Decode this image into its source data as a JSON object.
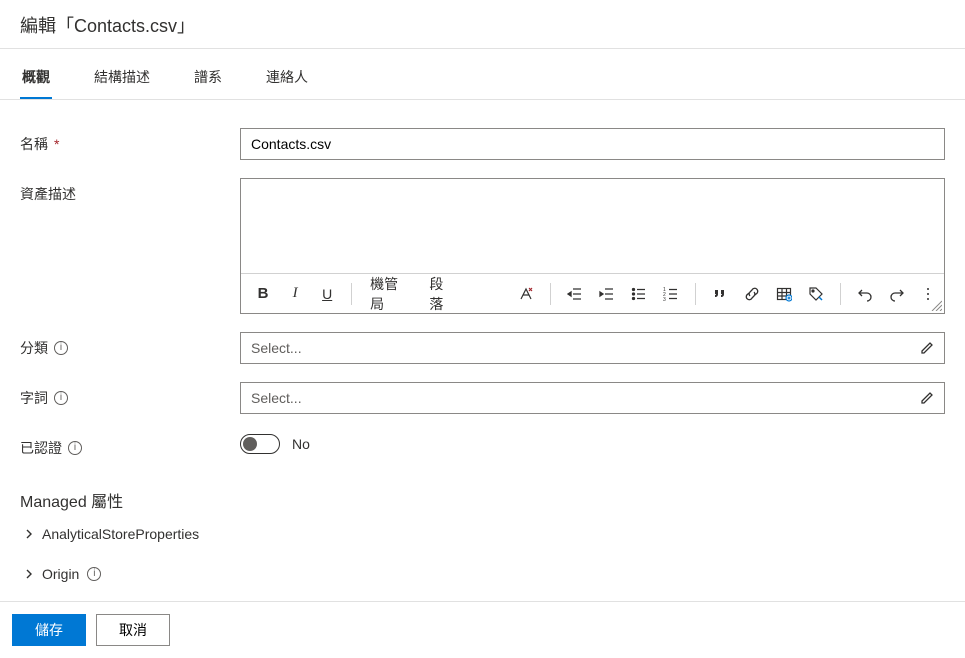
{
  "page_title": "編輯「Contacts.csv」",
  "tabs": [
    {
      "label": "概觀",
      "active": true
    },
    {
      "label": "結構描述",
      "active": false
    },
    {
      "label": "譜系",
      "active": false
    },
    {
      "label": "連絡人",
      "active": false
    }
  ],
  "fields": {
    "name": {
      "label": "名稱",
      "required": true,
      "value": "Contacts.csv"
    },
    "description": {
      "label": "資產描述",
      "value": ""
    },
    "classification": {
      "label": "分類",
      "info": true,
      "placeholder": "Select..."
    },
    "terms": {
      "label": "字詞",
      "info": true,
      "placeholder": "Select..."
    },
    "certified": {
      "label": "已認證",
      "info": true,
      "value_text": "No",
      "on": false
    }
  },
  "toolbar": {
    "bold": "B",
    "italic": "I",
    "underline": "U",
    "font_label": "機管局",
    "paragraph_label": "段落"
  },
  "managed": {
    "heading": "Managed 屬性",
    "items": [
      {
        "label": "AnalyticalStoreProperties",
        "info": false
      },
      {
        "label": "Origin",
        "info": true
      }
    ]
  },
  "footer": {
    "save": "儲存",
    "cancel": "取消"
  }
}
